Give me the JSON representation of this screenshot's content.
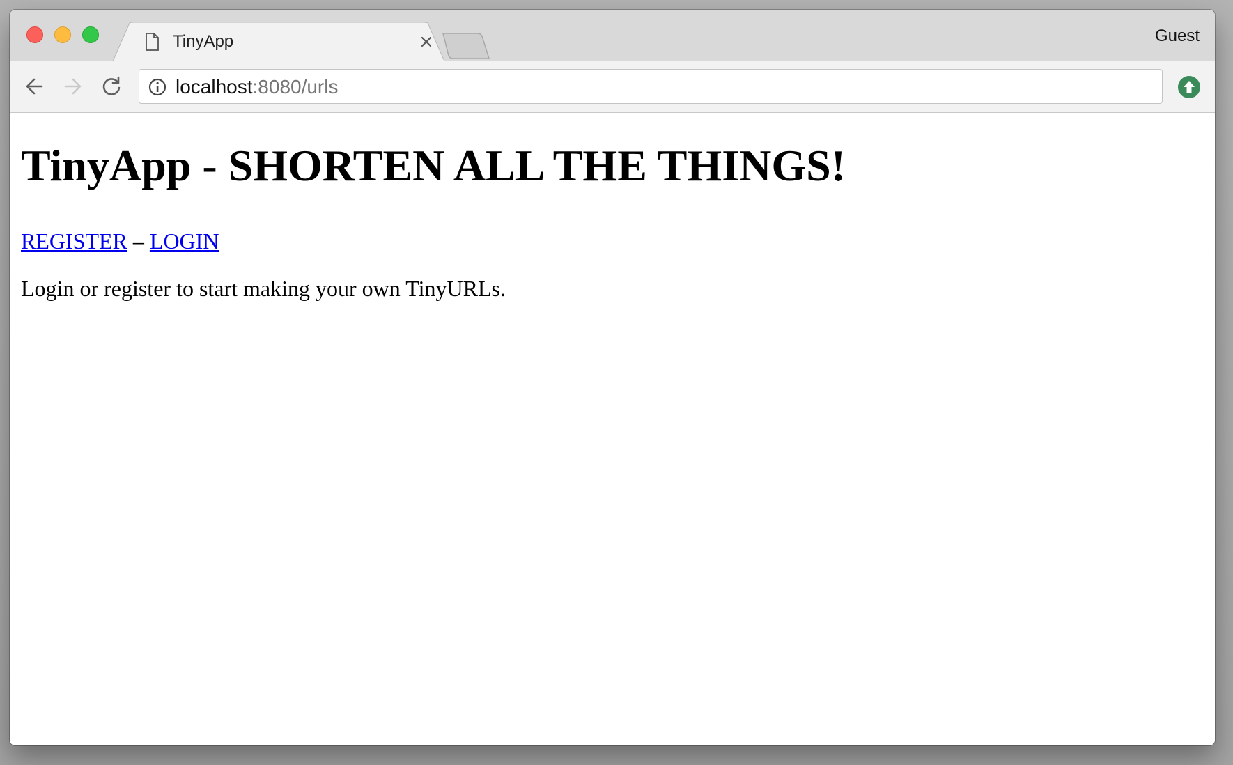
{
  "browser": {
    "tab": {
      "title": "TinyApp",
      "close_icon": "close-icon",
      "page_icon": "document-icon"
    },
    "new_tab_icon": "new-tab-icon",
    "profile": "Guest",
    "address_bar": {
      "host": "localhost",
      "path": ":8080/urls",
      "info_icon": "info-icon"
    },
    "nav_icons": [
      "back-arrow-icon",
      "forward-arrow-icon",
      "reload-icon"
    ],
    "extension_icon": "update-arrow-icon",
    "colors": {
      "close": "#fc605b",
      "minimize": "#fdbc40",
      "maximize": "#34c84a",
      "extension": "#3a8a5a",
      "link": "#0000ee"
    }
  },
  "page": {
    "heading": "TinyApp - SHORTEN ALL THE THINGS!",
    "nav": {
      "register": "REGISTER",
      "separator": " – ",
      "login": "LOGIN"
    },
    "message": "Login or register to start making your own TinyURLs."
  }
}
